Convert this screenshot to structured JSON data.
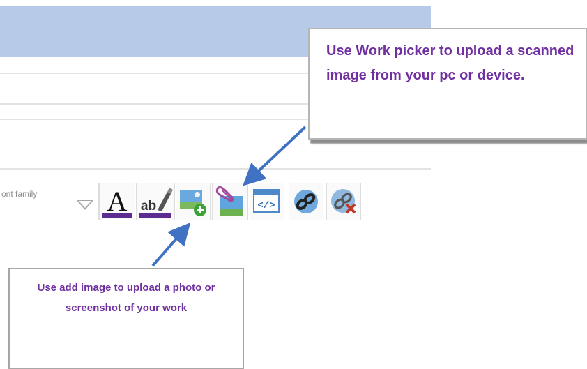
{
  "toolbar": {
    "font_family_placeholder": "ont family",
    "buttons": [
      {
        "name": "text-color-icon",
        "label": "A"
      },
      {
        "name": "highlight-color-icon",
        "label": "ab"
      },
      {
        "name": "add-image-icon"
      },
      {
        "name": "work-picker-icon"
      },
      {
        "name": "html-source-icon",
        "label": "</>"
      },
      {
        "name": "insert-link-icon"
      },
      {
        "name": "remove-link-icon"
      }
    ]
  },
  "callouts": {
    "work_picker": "Use Work picker to upload a scanned image from your pc or device.",
    "add_image": "Use add image to upload a photo or screenshot of your work"
  },
  "colors": {
    "header_bar": "#b7cbe9",
    "callout_text": "#7030a0",
    "arrow": "#3f72c2",
    "underline_purple": "#5b2d91"
  }
}
